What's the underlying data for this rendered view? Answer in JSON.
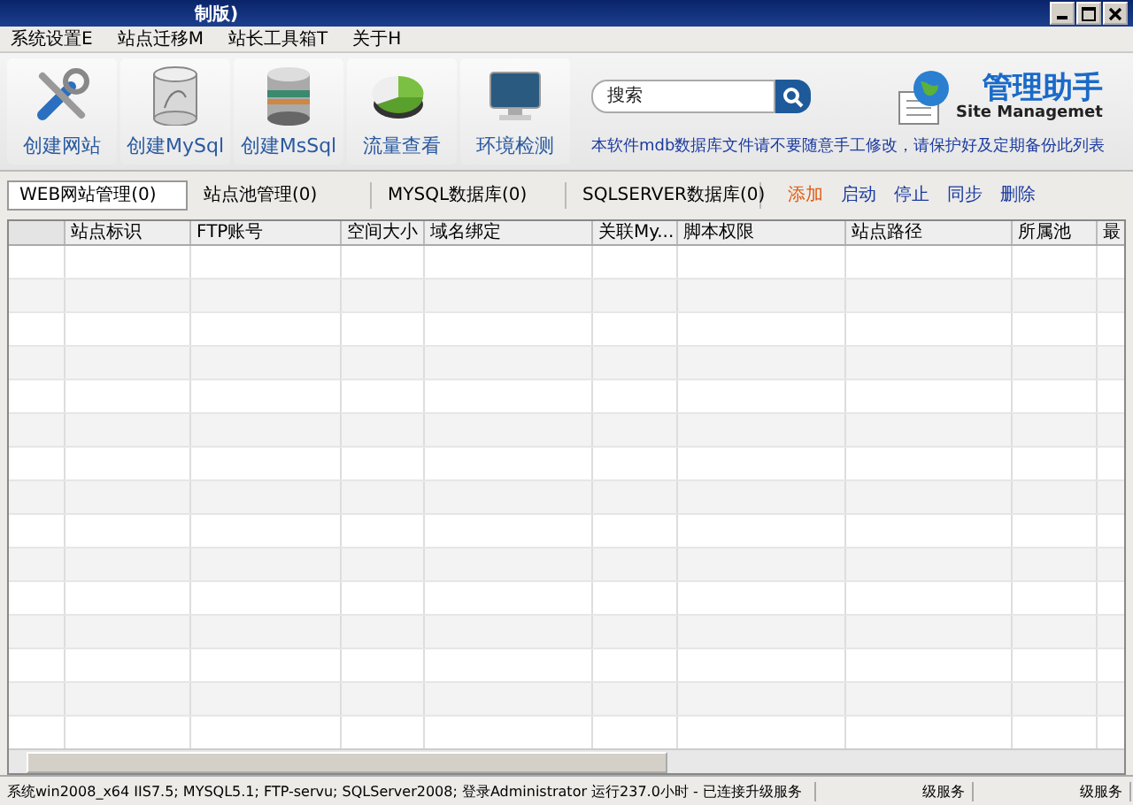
{
  "window": {
    "title": "制版)"
  },
  "menu": [
    "系统设置E",
    "站点迁移M",
    "站长工具箱T",
    "关于H"
  ],
  "toolbar": [
    {
      "label": "创建网站",
      "kind": "tools"
    },
    {
      "label": "创建MySql",
      "kind": "mysql"
    },
    {
      "label": "创建MsSql",
      "kind": "mssql"
    },
    {
      "label": "流量查看",
      "kind": "chart"
    },
    {
      "label": "环境检测",
      "kind": "monitor"
    }
  ],
  "search": {
    "placeholder": "搜索"
  },
  "logo": {
    "title": "管理助手",
    "subtitle": "Site Managemet"
  },
  "notice": "本软件mdb数据库文件请不要随意手工修改，请保护好及定期备份此列表",
  "tabs": [
    {
      "label": "WEB网站管理(0)",
      "selected": true
    },
    {
      "label": "站点池管理(0)",
      "selected": false
    },
    {
      "label": "MYSQL数据库(0)",
      "selected": false
    },
    {
      "label": "SQLSERVER数据库(0)",
      "selected": false
    }
  ],
  "actions": [
    {
      "label": "添加",
      "color": "#e05a10"
    },
    {
      "label": "启动",
      "color": "#1a3aa0"
    },
    {
      "label": "停止",
      "color": "#1a3aa0"
    },
    {
      "label": "同步",
      "color": "#1a3aa0"
    },
    {
      "label": "删除",
      "color": "#1a3aa0"
    }
  ],
  "table": {
    "columns": [
      "",
      "站点标识",
      "FTP账号",
      "空间大小",
      "域名绑定",
      "关联My...",
      "脚本权限",
      "站点路径",
      "所属池",
      "最"
    ]
  },
  "status_bar": [
    "系统win2008_x64 IIS7.5; MYSQL5.1; FTP-servu; SQLServer2008; 登录Administrator 运行237.0小时 - 已连接升级服务",
    "级服务",
    "级服务"
  ]
}
